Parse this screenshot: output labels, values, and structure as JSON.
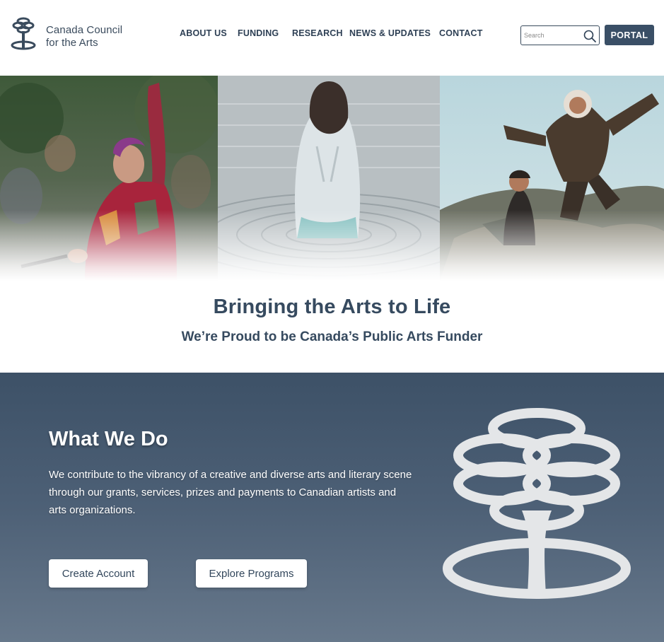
{
  "brand": {
    "line1": "Canada Council",
    "line2": "for the Arts"
  },
  "nav": {
    "items": [
      {
        "label": "ABOUT US"
      },
      {
        "label": "FUNDING"
      },
      {
        "label": "RESEARCH"
      },
      {
        "label": "NEWS & UPDATES"
      },
      {
        "label": "CONTACT"
      }
    ]
  },
  "search": {
    "placeholder": "Search",
    "value": ""
  },
  "portal": {
    "label": "PORTAL"
  },
  "hero": {
    "photos": [
      "performer-singing-photo",
      "figure-in-water-photo",
      "jumping-on-rocks-photo"
    ]
  },
  "tagline": {
    "title": "Bringing the Arts to Life",
    "subtitle": "We’re Proud to be Canada’s Public Arts Funder"
  },
  "what_we_do": {
    "title": "What We Do",
    "body": "We contribute to the vibrancy of a creative and diverse arts and literary scene through our grants, services, prizes and payments to Canadian artists and arts organizations.",
    "create_account_label": "Create Account",
    "explore_programs_label": "Explore Programs"
  },
  "colors": {
    "brand_navy": "#3a4f66",
    "heading_text": "#364a5f",
    "section_bg_top": "#3d5167",
    "section_bg_bottom": "#67788b"
  }
}
